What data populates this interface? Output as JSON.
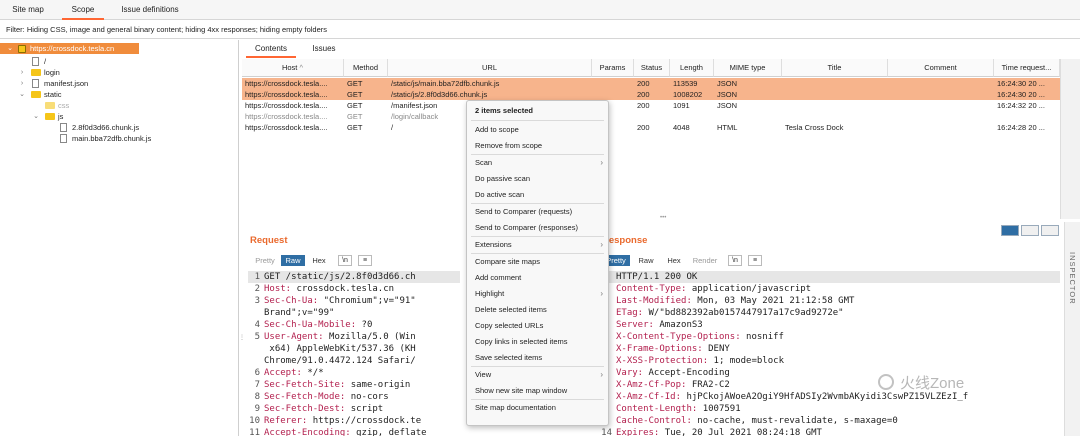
{
  "tabs": [
    "Site map",
    "Scope",
    "Issue definitions"
  ],
  "filter_text": "Filter: Hiding CSS, image and general binary content;  hiding 4xx responses;  hiding empty folders",
  "tree": {
    "root": "https://crossdock.tesla.cn",
    "items": [
      "/",
      "login",
      "manifest.json",
      "static",
      "css",
      "js",
      "2.8f0d3d66.chunk.js",
      "main.bba72dfb.chunk.js"
    ]
  },
  "content_tabs": [
    "Contents",
    "Issues"
  ],
  "table": {
    "columns": [
      "Host",
      "Method",
      "URL",
      "Params",
      "Status",
      "Length",
      "MIME type",
      "Title",
      "Comment",
      "Time request..."
    ],
    "sort_indicator": "^",
    "rows": [
      [
        "https://crossdock.tesla....",
        "GET",
        "/static/js/main.bba72dfb.chunk.js",
        "",
        "200",
        "113539",
        "JSON",
        "",
        "",
        "16:24:30 20 ..."
      ],
      [
        "https://crossdock.tesla....",
        "GET",
        "/static/js/2.8f0d3d66.chunk.js",
        "",
        "200",
        "1008202",
        "JSON",
        "",
        "",
        "16:24:30 20 ..."
      ],
      [
        "https://crossdock.tesla....",
        "GET",
        "/manifest.json",
        "",
        "200",
        "1091",
        "JSON",
        "",
        "",
        "16:24:32 20 ..."
      ],
      [
        "https://crossdock.tesla....",
        "GET",
        "/login/callback",
        "",
        "",
        "",
        "",
        "",
        "",
        ""
      ],
      [
        "https://crossdock.tesla....",
        "GET",
        "/",
        "",
        "200",
        "4048",
        "HTML",
        "Tesla Cross Dock",
        "",
        "16:24:28 20 ..."
      ]
    ]
  },
  "request": {
    "title": "Request",
    "modes": [
      "Pretty",
      "Raw",
      "Hex"
    ],
    "newline_btn": "\\n",
    "menu_btn": "≡",
    "lines": [
      {
        "n": "1",
        "k": "",
        "v": "GET /static/js/2.8f0d3d66.ch"
      },
      {
        "n": "2",
        "k": "Host:",
        "v": " crossdock.tesla.cn"
      },
      {
        "n": "3",
        "k": "Sec-Ch-Ua:",
        "v": " \"Chromium\";v=\"91\""
      },
      {
        "n": "",
        "k": "",
        "v": "Brand\";v=\"99\""
      },
      {
        "n": "4",
        "k": "Sec-Ch-Ua-Mobile:",
        "v": " ?0"
      },
      {
        "n": "5",
        "k": "User-Agent:",
        "v": " Mozilla/5.0 (Win"
      },
      {
        "n": "",
        "k": "",
        "v": " x64) AppleWebKit/537.36 (KH"
      },
      {
        "n": "",
        "k": "",
        "v": "Chrome/91.0.4472.124 Safari/"
      },
      {
        "n": "6",
        "k": "Accept:",
        "v": " */*"
      },
      {
        "n": "7",
        "k": "Sec-Fetch-Site:",
        "v": " same-origin"
      },
      {
        "n": "8",
        "k": "Sec-Fetch-Mode:",
        "v": " no-cors"
      },
      {
        "n": "9",
        "k": "Sec-Fetch-Dest:",
        "v": " script"
      },
      {
        "n": "10",
        "k": "Referer:",
        "v": " https://crossdock.te"
      },
      {
        "n": "11",
        "k": "Accept-Encoding:",
        "v": " gzip, deflate"
      }
    ]
  },
  "response": {
    "title": "Response",
    "modes": [
      "Pretty",
      "Raw",
      "Hex",
      "Render"
    ],
    "newline_btn": "\\n",
    "menu_btn": "≡",
    "lines": [
      {
        "n": "",
        "k": "",
        "v": "HTTP/1.1 200 OK"
      },
      {
        "n": "",
        "k": "Content-Type:",
        "v": " application/javascript"
      },
      {
        "n": "",
        "k": "Last-Modified:",
        "v": " Mon, 03 May 2021 21:12:58 GMT"
      },
      {
        "n": "",
        "k": "ETag:",
        "v": " W/\"bd882392ab0157447917a17c9ad9272e\""
      },
      {
        "n": "",
        "k": "Server:",
        "v": " AmazonS3"
      },
      {
        "n": "",
        "k": "X-Content-Type-Options:",
        "v": " nosniff"
      },
      {
        "n": "",
        "k": "X-Frame-Options:",
        "v": " DENY"
      },
      {
        "n": "",
        "k": "X-XSS-Protection:",
        "v": " 1; mode=block"
      },
      {
        "n": "",
        "k": "Vary:",
        "v": " Accept-Encoding"
      },
      {
        "n": "",
        "k": "X-Amz-Cf-Pop:",
        "v": " FRA2-C2"
      },
      {
        "n": "",
        "k": "X-Amz-Cf-Id:",
        "v": " hjPCkojAWoeA2OgiY9HfADSIy2WvmbAKyidi3CswPZ15VLZEzI_f"
      },
      {
        "n": "",
        "k": "Content-Length:",
        "v": " 1007591"
      },
      {
        "n": "",
        "k": "Cache-Control:",
        "v": " no-cache, must-revalidate, s-maxage=0"
      },
      {
        "n": "14",
        "k": "Expires:",
        "v": " Tue, 20 Jul 2021 08:24:18 GMT"
      }
    ]
  },
  "inspector_label": "INSPECTOR",
  "context_menu": {
    "header": "2 items selected",
    "items": [
      "Add to scope",
      "Remove from scope",
      "Scan",
      "Do passive scan",
      "Do active scan",
      "Send to Comparer (requests)",
      "Send to Comparer (responses)",
      "Extensions",
      "Compare site maps",
      "Add comment",
      "Highlight",
      "Delete selected items",
      "Copy selected URLs",
      "Copy links in selected items",
      "Save selected items",
      "View",
      "Show new site map window",
      "Site map documentation"
    ]
  },
  "watermark": "火线Zone",
  "colors": {
    "accent": "#ff6633",
    "selected_row": "#f7b48c",
    "header_key": "#b3214f",
    "raw_button": "#2f6ea4"
  }
}
